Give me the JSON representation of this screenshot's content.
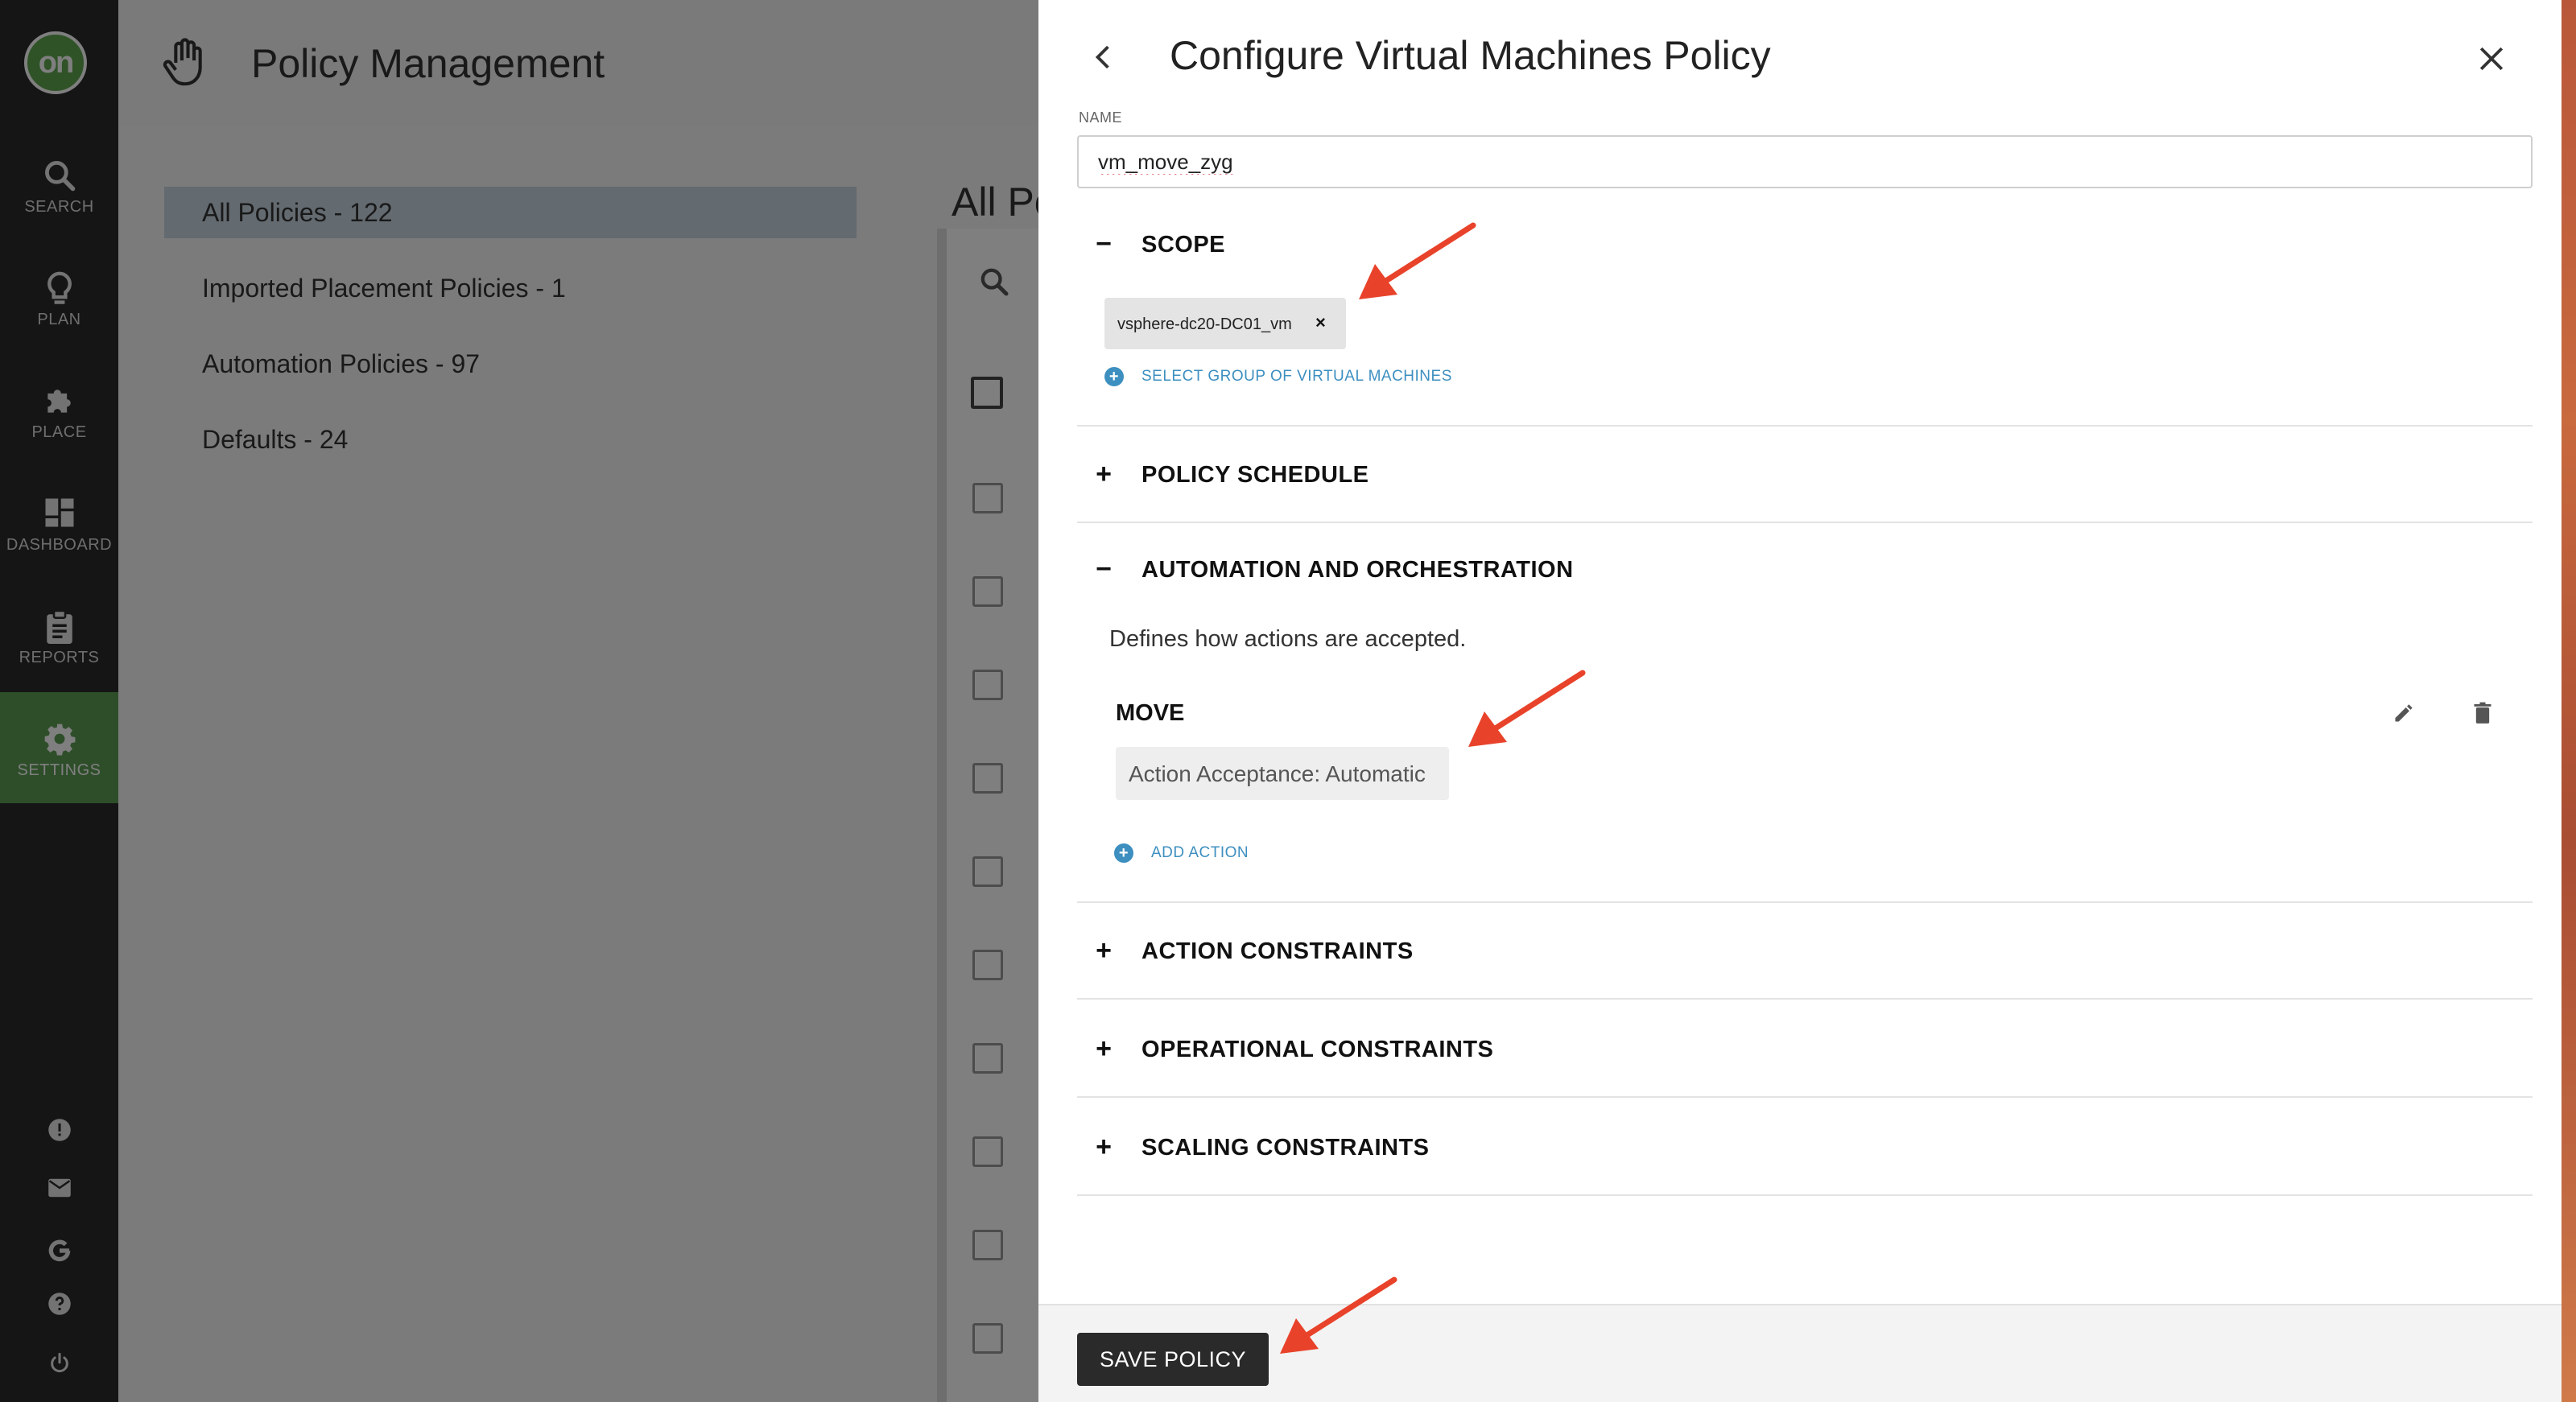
{
  "nav": {
    "logo": "on",
    "items": [
      {
        "label": "SEARCH",
        "icon": "search-icon"
      },
      {
        "label": "PLAN",
        "icon": "lightbulb-icon"
      },
      {
        "label": "PLACE",
        "icon": "puzzle-icon"
      },
      {
        "label": "DASHBOARD",
        "icon": "dashboard-icon"
      },
      {
        "label": "REPORTS",
        "icon": "clipboard-icon"
      },
      {
        "label": "SETTINGS",
        "icon": "gear-icon"
      }
    ],
    "bottom_icons": [
      "alert-icon",
      "mail-icon",
      "google-icon",
      "help-icon",
      "power-icon"
    ]
  },
  "background": {
    "title": "Policy Management",
    "sidebar": [
      {
        "label": "All Policies - 122",
        "active": true
      },
      {
        "label": "Imported Placement Policies - 1"
      },
      {
        "label": "Automation Policies - 97"
      },
      {
        "label": "Defaults - 24"
      }
    ],
    "main_heading": "All Po"
  },
  "panel": {
    "title": "Configure Virtual Machines Policy",
    "name_label": "NAME",
    "name_value": "vm_move_zyg",
    "sections": {
      "scope": {
        "toggle": "−",
        "title": "SCOPE"
      },
      "schedule": {
        "toggle": "+",
        "title": "POLICY SCHEDULE"
      },
      "automation": {
        "toggle": "−",
        "title": "AUTOMATION AND ORCHESTRATION"
      },
      "action_constraints": {
        "toggle": "+",
        "title": "ACTION CONSTRAINTS"
      },
      "operational_constraints": {
        "toggle": "+",
        "title": "OPERATIONAL CONSTRAINTS"
      },
      "scaling_constraints": {
        "toggle": "+",
        "title": "SCALING CONSTRAINTS"
      }
    },
    "scope_chip": "vsphere-dc20-DC01_vm",
    "scope_chip_remove": "×",
    "select_group_link": "SELECT GROUP OF VIRTUAL MACHINES",
    "automation_desc": "Defines how actions are accepted.",
    "move_title": "MOVE",
    "action_acceptance": "Action Acceptance: Automatic",
    "add_action_link": "ADD ACTION",
    "save_button": "SAVE POLICY"
  },
  "colors": {
    "nav_bg": "#2b2b2b",
    "nav_active": "#5d9c55",
    "link_blue": "#3d8fc0",
    "annotation_arrow": "#e8432a",
    "save_bg": "#2a2a2a"
  }
}
